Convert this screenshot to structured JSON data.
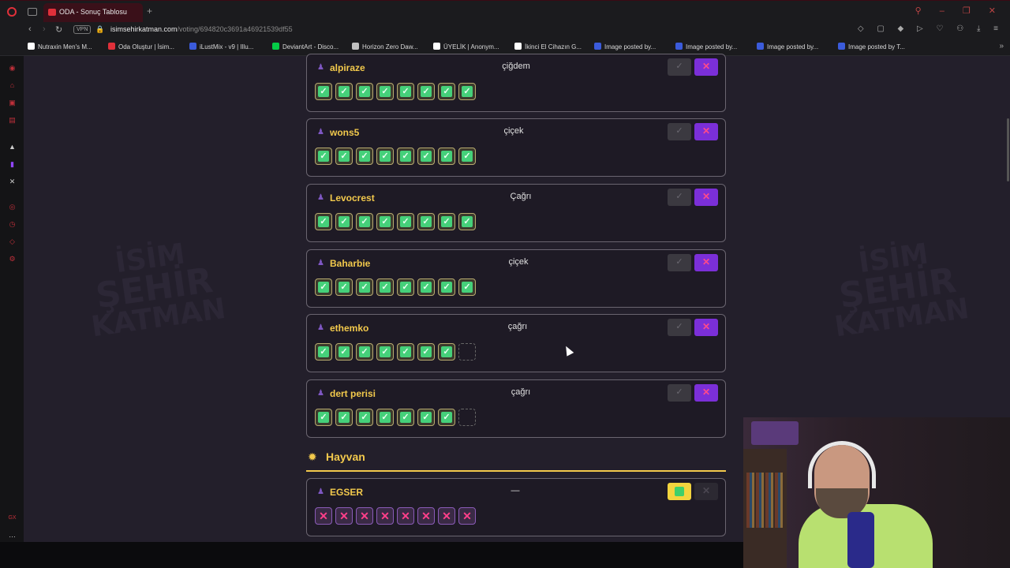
{
  "browser": {
    "tab_title": "ODA - Sonuç Tablosu",
    "vpn_label": "VPN",
    "url_host": "isimsehirkatman.com",
    "url_path": "/voting/694820c3691a46921539df55",
    "bookmarks": [
      {
        "label": "Nutraxin Men's M...",
        "color": "#ffffff"
      },
      {
        "label": "Oda Oluştur | İsim...",
        "color": "#e0303a"
      },
      {
        "label": "iLustMix - v9 | Illu...",
        "color": "#3b5bdb"
      },
      {
        "label": "DeviantArt - Disco...",
        "color": "#05cc47"
      },
      {
        "label": "Horizon Zero Daw...",
        "color": "#c0c0c0"
      },
      {
        "label": "ÜYELİK | Anonym...",
        "color": "#ffffff"
      },
      {
        "label": "İkinci El Cihazın G...",
        "color": "#ffffff"
      },
      {
        "label": "Image posted by...",
        "color": "#3b5bdb"
      },
      {
        "label": "Image posted by...",
        "color": "#3b5bdb"
      },
      {
        "label": "Image posted by...",
        "color": "#3b5bdb"
      },
      {
        "label": "Image posted by T...",
        "color": "#3b5bdb"
      }
    ]
  },
  "watermark": {
    "line1": "İSİM",
    "line2": "ŞEHİR",
    "line3": "KATMAN"
  },
  "votes_list": [
    {
      "username": "alpiraze",
      "answer": "çiğdem",
      "votes": [
        "yes",
        "yes",
        "yes",
        "yes",
        "yes",
        "yes",
        "yes",
        "yes"
      ],
      "approved": false
    },
    {
      "username": "wons5",
      "answer": "çiçek",
      "votes": [
        "yes",
        "yes",
        "yes",
        "yes",
        "yes",
        "yes",
        "yes",
        "yes"
      ],
      "approved": false
    },
    {
      "username": "Levocrest",
      "answer": "Çağrı",
      "votes": [
        "yes",
        "yes",
        "yes",
        "yes",
        "yes",
        "yes",
        "yes",
        "yes"
      ],
      "approved": false
    },
    {
      "username": "Baharbie",
      "answer": "çiçek",
      "votes": [
        "yes",
        "yes",
        "yes",
        "yes",
        "yes",
        "yes",
        "yes",
        "yes"
      ],
      "approved": false
    },
    {
      "username": "ethemko",
      "answer": "çağrı",
      "votes": [
        "yes",
        "yes",
        "yes",
        "yes",
        "yes",
        "yes",
        "yes",
        "empty"
      ],
      "approved": false
    },
    {
      "username": "dert perisi",
      "answer": "çağrı",
      "votes": [
        "yes",
        "yes",
        "yes",
        "yes",
        "yes",
        "yes",
        "yes",
        "empty"
      ],
      "approved": false
    }
  ],
  "section": {
    "title": "Hayvan",
    "rows": [
      {
        "username": "EGSER",
        "answer": "—",
        "votes": [
          "no",
          "no",
          "no",
          "no",
          "no",
          "no",
          "no",
          "no"
        ],
        "approved": true
      }
    ]
  },
  "colors": {
    "accent_yellow": "#f2c94c",
    "reject_purple": "#7b2fd8",
    "approve_green": "#45d07a",
    "reject_pink": "#ff3f8a"
  }
}
